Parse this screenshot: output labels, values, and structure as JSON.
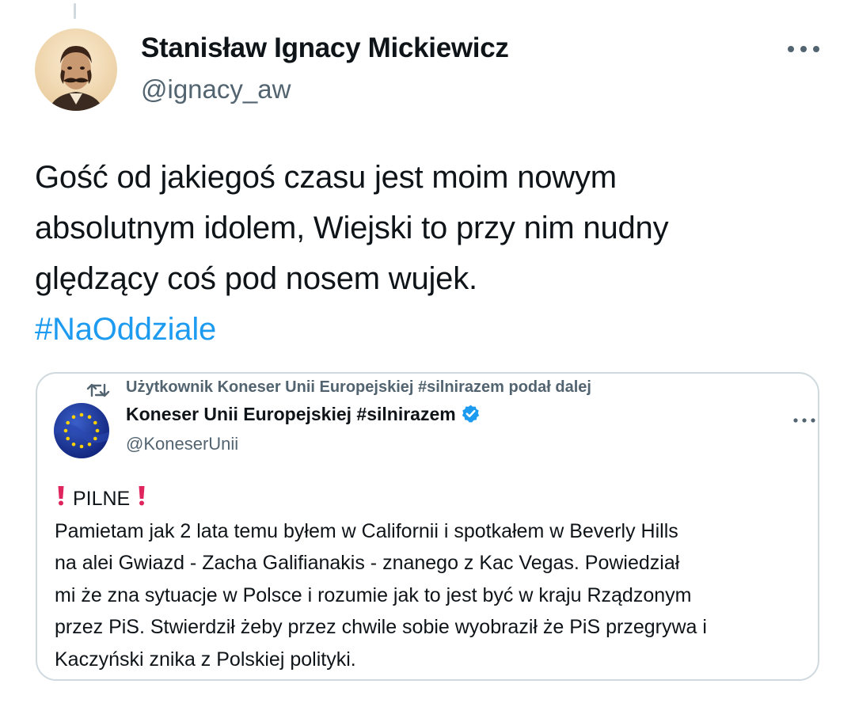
{
  "tweet": {
    "author": {
      "display_name": "Stanisław Ignacy Mickiewicz",
      "handle": "@ignacy_aw",
      "avatar_icon": "portrait-avatar"
    },
    "more_icon": "more-horizontal-icon",
    "text_lines": [
      "Gość od jakiegoś czasu jest moim nowym",
      "absolutnym idolem, Wiejski to przy nim nudny",
      "ględzący coś pod nosem wujek."
    ],
    "hashtag": "#NaOddziale"
  },
  "quote": {
    "repost_icon": "repost-icon",
    "repost_label": "Użytkownik Koneser Unii Europejskiej #silnirazem podał dalej",
    "author": {
      "display_name": "Koneser Unii Europejskiej #silnirazem",
      "handle": "@KoneserUnii",
      "verified": true,
      "verified_icon": "verified-badge-icon",
      "avatar_icon": "eu-flag-avatar"
    },
    "headline": "PILNE",
    "headline_icon": "exclamation-icon",
    "body_lines": [
      "Pamietam jak 2 lata temu byłem w Californii i spotkałem w Beverly Hills",
      "na alei Gwiazd - Zacha Galifianakis - znanego z  Kac Vegas. Powiedział",
      "mi że zna sytuacje w Polsce i rozumie jak to jest być w kraju Rządzonym",
      "przez PiS. Stwierdził żeby przez chwile sobie wyobraził że PiS przegrywa i",
      "Kaczyński znika z Polskiej polityki."
    ]
  },
  "colors": {
    "text": "#0f1419",
    "secondary": "#536471",
    "link": "#1d9bf0",
    "border": "#cfd9de",
    "verified": "#1d9bf0",
    "alert_red": "#e0245e"
  }
}
